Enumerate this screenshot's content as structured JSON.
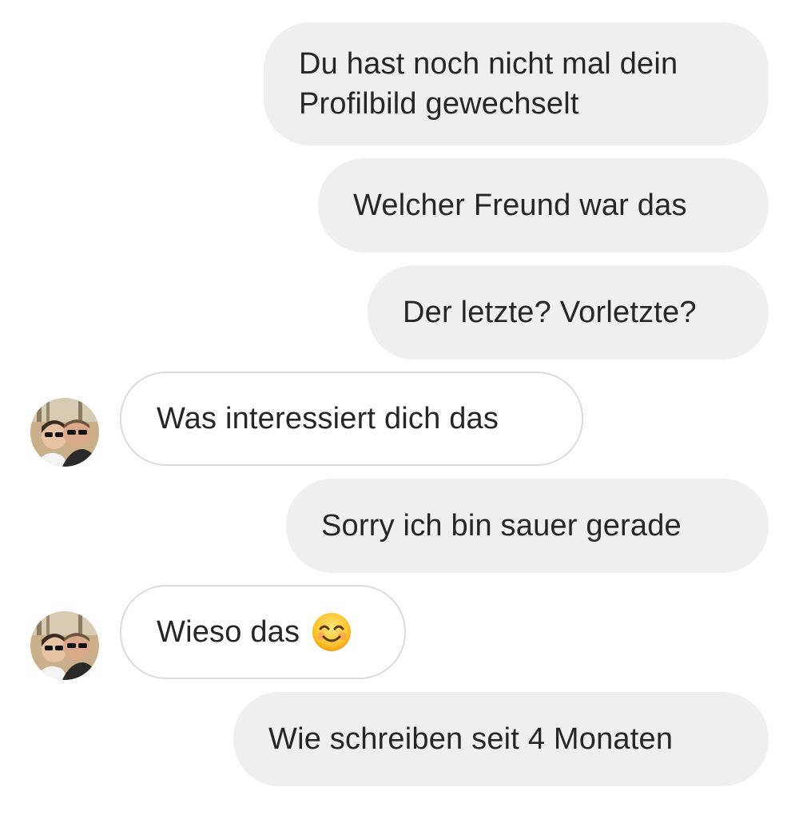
{
  "conversation": {
    "messages": [
      {
        "direction": "sent",
        "text": "Du hast noch nicht mal dein\nProfilbild gewechselt"
      },
      {
        "direction": "sent",
        "text": "Welcher Freund war das"
      },
      {
        "direction": "sent",
        "text": "Der letzte? Vorletzte?"
      },
      {
        "direction": "received",
        "text": "Was interessiert dich das"
      },
      {
        "direction": "sent",
        "text": "Sorry ich bin sauer gerade"
      },
      {
        "direction": "received",
        "text": "Wieso das",
        "emoji": "smiling-face-with-smiling-eyes"
      },
      {
        "direction": "sent",
        "text": "Wie schreiben seit 4 Monaten"
      }
    ],
    "avatar_icon": "contact-avatar-photo",
    "colors": {
      "sent_bubble": "#efefef",
      "received_border": "#dbdbdb",
      "text": "#262626"
    }
  }
}
